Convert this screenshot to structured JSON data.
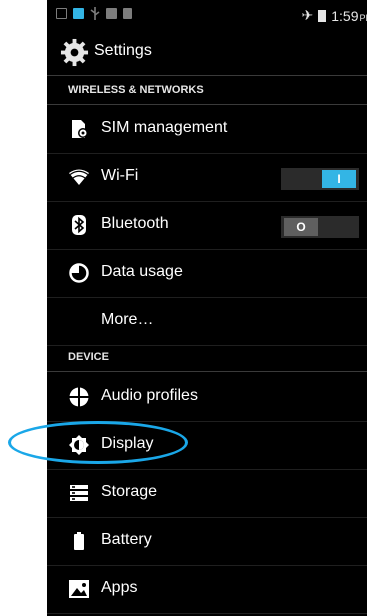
{
  "statusbar": {
    "time": "1:59",
    "ampm": "PM",
    "icons": [
      "notification-icon",
      "sim-icon",
      "usb-icon",
      "storage-icon",
      "signal-icon",
      "airplane-icon",
      "battery-icon"
    ]
  },
  "actionbar": {
    "title": "Settings",
    "icon": "gear-icon"
  },
  "sections": {
    "wireless": {
      "header": "WIRELESS & NETWORKS"
    },
    "device": {
      "header": "DEVICE"
    }
  },
  "items": {
    "sim": {
      "label": "SIM management",
      "icon": "sim-settings-icon"
    },
    "wifi": {
      "label": "Wi-Fi",
      "icon": "wifi-icon",
      "toggle": "I",
      "toggle_state": "on"
    },
    "bluetooth": {
      "label": "Bluetooth",
      "icon": "bluetooth-icon",
      "toggle": "O",
      "toggle_state": "off"
    },
    "data": {
      "label": "Data usage",
      "icon": "data-usage-icon"
    },
    "more": {
      "label": "More…"
    },
    "audio": {
      "label": "Audio profiles",
      "icon": "audio-profiles-icon"
    },
    "display": {
      "label": "Display",
      "icon": "display-brightness-icon"
    },
    "storage": {
      "label": "Storage",
      "icon": "storage-icon"
    },
    "battery": {
      "label": "Battery",
      "icon": "battery-icon"
    },
    "apps": {
      "label": "Apps",
      "icon": "apps-icon"
    }
  },
  "colors": {
    "accent": "#33b5e5",
    "background": "#000000",
    "annotation": "#1aa7e8"
  }
}
